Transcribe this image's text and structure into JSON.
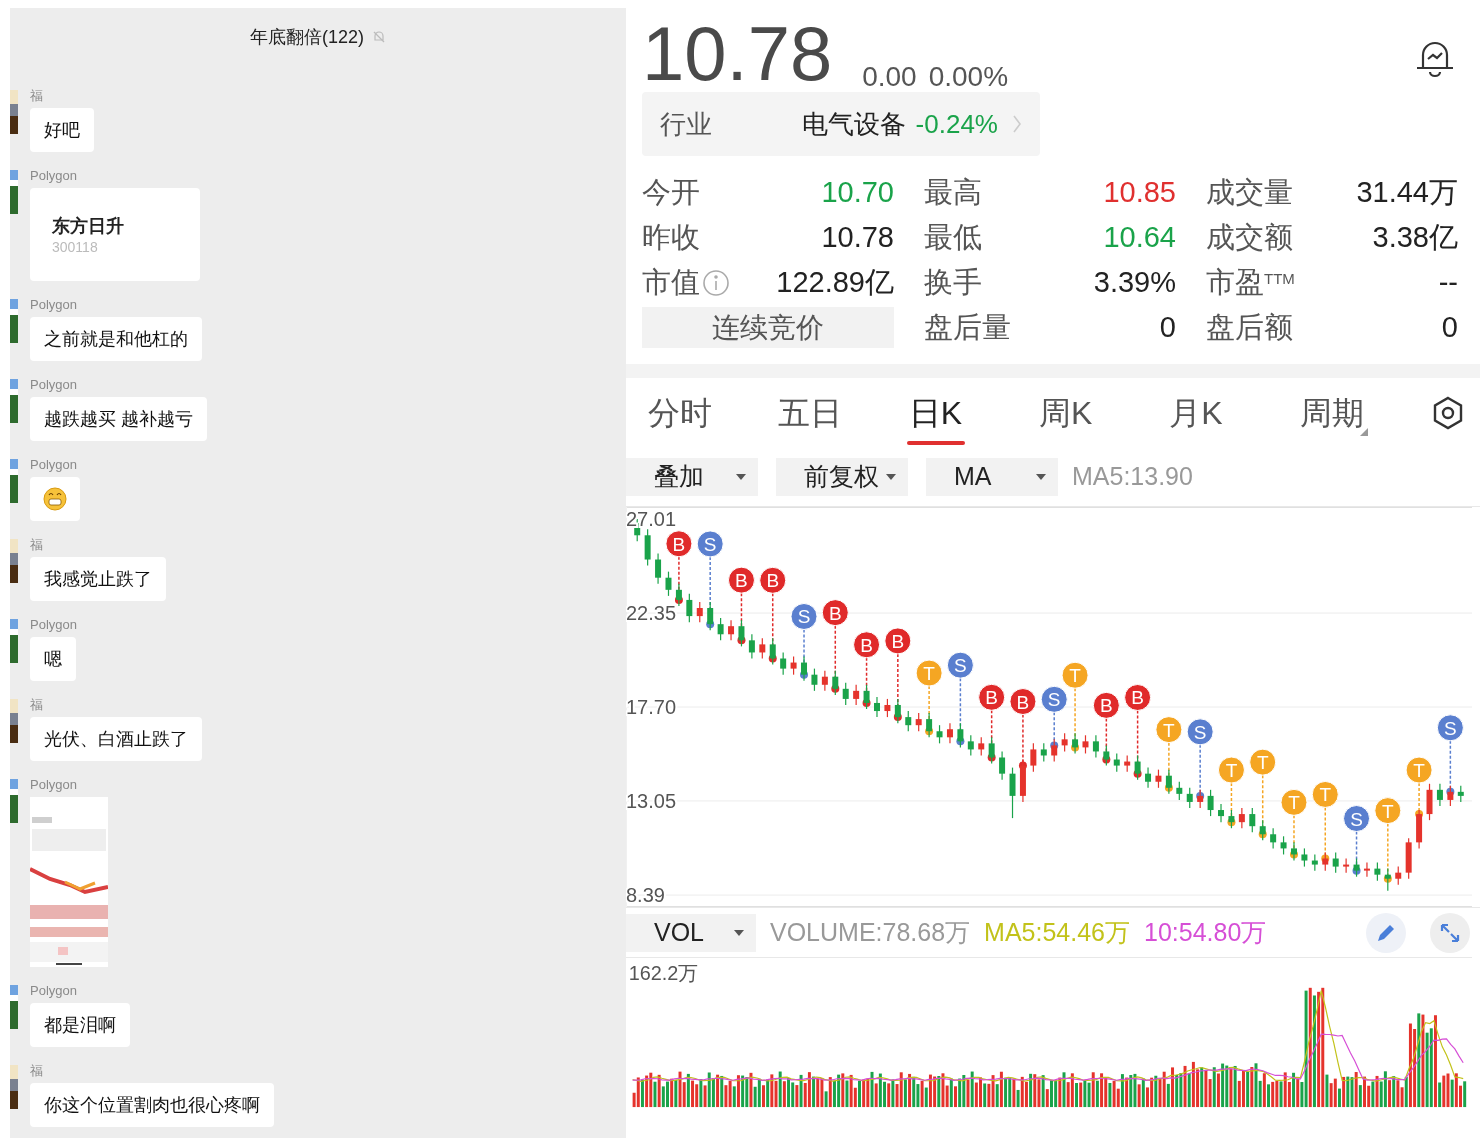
{
  "chat": {
    "title": "年底翻倍(122)",
    "muted": true,
    "messages": [
      {
        "sender": "福",
        "kind": "text",
        "text": "好吧"
      },
      {
        "sender": "Polygon",
        "kind": "stock_card",
        "name": "东方日升",
        "code": "300118"
      },
      {
        "sender": "Polygon",
        "kind": "text",
        "text": "之前就是和他杠的"
      },
      {
        "sender": "Polygon",
        "kind": "text",
        "text": "越跌越买 越补越亏"
      },
      {
        "sender": "Polygon",
        "kind": "emoji"
      },
      {
        "sender": "福",
        "kind": "text",
        "text": "我感觉止跌了"
      },
      {
        "sender": "Polygon",
        "kind": "text",
        "text": "嗯"
      },
      {
        "sender": "福",
        "kind": "text",
        "text": "光伏、白酒止跌了"
      },
      {
        "sender": "Polygon"
      },
      {
        "sender": "Polygon",
        "kind": "text",
        "text": "都是泪啊"
      },
      {
        "sender": "福",
        "kind": "text",
        "text": "你这个位置割肉也很心疼啊"
      }
    ]
  },
  "quote": {
    "price": "10.78",
    "change": "0.00",
    "change_pct": "0.00%",
    "industry": {
      "label": "行业",
      "name": "电气设备",
      "change": "-0.24%"
    },
    "stats": [
      {
        "kind": "stat",
        "label": "今开",
        "value": "10.70",
        "color": "#1aa34a",
        "info": false
      },
      {
        "kind": "stat",
        "label": "最高",
        "value": "10.85",
        "color": "#e0302f",
        "info": false
      },
      {
        "kind": "stat",
        "label": "成交量",
        "value": "31.44万",
        "color": "#222222",
        "info": false
      },
      {
        "kind": "stat",
        "label": "昨收",
        "value": "10.78",
        "color": "#222222",
        "info": false
      },
      {
        "kind": "stat",
        "label": "最低",
        "value": "10.64",
        "color": "#1aa34a",
        "info": false
      },
      {
        "kind": "stat",
        "label": "成交额",
        "value": "3.38亿",
        "color": "#222222",
        "info": false
      },
      {
        "kind": "stat",
        "label": "市值",
        "value": "122.89亿",
        "color": "#222222",
        "info": true
      },
      {
        "kind": "stat",
        "label": "换手",
        "value": "3.39%",
        "color": "#222222",
        "info": false
      },
      {
        "kind": "stat",
        "label": "市盈$^{TTM}$",
        "value": "--",
        "color": "#222222",
        "info": false
      },
      {
        "kind": "button",
        "label": "连续竞价"
      },
      {
        "kind": "stat",
        "label": "盘后量",
        "value": "0",
        "color": "#222222",
        "info": false
      },
      {
        "kind": "stat",
        "label": "盘后额",
        "value": "0",
        "color": "#222222",
        "info": false
      }
    ]
  },
  "tabs": [
    {
      "label": "分时",
      "selected": false,
      "menu": false
    },
    {
      "label": "五日",
      "selected": false,
      "menu": false
    },
    {
      "label": "日K",
      "selected": true,
      "menu": false
    },
    {
      "label": "周K",
      "selected": false,
      "menu": false
    },
    {
      "label": "月K",
      "selected": false,
      "menu": false
    },
    {
      "label": "周期",
      "selected": false,
      "menu": true
    }
  ],
  "toolbar": {
    "dropdowns": [
      "叠加",
      "前复权",
      "MA"
    ],
    "reading": "MA5:13.90"
  },
  "chart": {
    "chart_data": {
      "type": "candlestick",
      "grid": true,
      "ylim": [
        7.8,
        27.6
      ],
      "yticks": [
        {
          "value": 27.01,
          "label": "27.01"
        },
        {
          "value": 22.35,
          "label": "22.35"
        },
        {
          "value": 17.7,
          "label": "17.70"
        },
        {
          "value": 13.05,
          "label": "13.05"
        },
        {
          "value": 8.39,
          "label": "8.39"
        }
      ],
      "ohlc": [
        [
          26.8,
          27.0,
          25.9,
          26.2
        ],
        [
          26.2,
          26.5,
          24.7,
          25.0
        ],
        [
          25.0,
          25.3,
          23.8,
          24.1
        ],
        [
          24.1,
          24.4,
          23.2,
          23.5
        ],
        [
          23.5,
          23.8,
          22.7,
          23.0
        ],
        [
          23.0,
          23.3,
          21.9,
          22.2
        ],
        [
          22.2,
          22.9,
          21.9,
          22.6
        ],
        [
          22.6,
          22.9,
          21.5,
          21.8
        ],
        [
          21.8,
          22.1,
          21.0,
          21.3
        ],
        [
          21.3,
          22.0,
          21.0,
          21.7
        ],
        [
          21.7,
          22.0,
          20.7,
          21.0
        ],
        [
          21.0,
          21.3,
          20.1,
          20.4
        ],
        [
          20.4,
          21.1,
          20.1,
          20.8
        ],
        [
          20.8,
          21.1,
          19.8,
          20.1
        ],
        [
          20.1,
          20.4,
          19.3,
          19.6
        ],
        [
          19.6,
          20.2,
          19.3,
          19.9
        ],
        [
          19.9,
          20.2,
          19.0,
          19.3
        ],
        [
          19.3,
          19.6,
          18.5,
          18.8
        ],
        [
          18.8,
          19.5,
          18.5,
          19.2
        ],
        [
          19.2,
          19.5,
          18.3,
          18.6
        ],
        [
          18.6,
          18.9,
          17.8,
          18.1
        ],
        [
          18.1,
          18.8,
          17.8,
          18.5
        ],
        [
          18.5,
          18.8,
          17.6,
          17.9
        ],
        [
          17.9,
          18.2,
          17.2,
          17.5
        ],
        [
          17.5,
          18.1,
          17.2,
          17.8
        ],
        [
          17.8,
          18.1,
          16.9,
          17.2
        ],
        [
          17.2,
          17.5,
          16.5,
          16.8
        ],
        [
          16.8,
          17.4,
          16.5,
          17.1
        ],
        [
          17.1,
          17.4,
          16.2,
          16.5
        ],
        [
          16.5,
          16.8,
          15.9,
          16.2
        ],
        [
          16.2,
          16.9,
          15.9,
          16.6
        ],
        [
          16.6,
          16.9,
          15.7,
          16.0
        ],
        [
          16.0,
          16.3,
          15.3,
          15.6
        ],
        [
          15.6,
          16.2,
          15.3,
          15.9
        ],
        [
          15.9,
          16.2,
          14.9,
          15.2
        ],
        [
          15.2,
          15.5,
          14.1,
          14.4
        ],
        [
          14.4,
          14.7,
          12.2,
          13.3
        ],
        [
          13.3,
          15.1,
          13.0,
          14.8
        ],
        [
          14.8,
          15.9,
          14.5,
          15.6
        ],
        [
          15.6,
          15.9,
          15.0,
          15.3
        ],
        [
          15.3,
          16.1,
          15.0,
          15.8
        ],
        [
          15.8,
          16.4,
          15.5,
          16.1
        ],
        [
          16.1,
          16.4,
          15.4,
          15.7
        ],
        [
          15.7,
          16.3,
          15.4,
          16.0
        ],
        [
          16.0,
          16.3,
          15.2,
          15.5
        ],
        [
          15.5,
          15.8,
          14.8,
          15.1
        ],
        [
          15.1,
          15.4,
          14.5,
          14.8
        ],
        [
          14.8,
          15.3,
          14.5,
          15.0
        ],
        [
          15.0,
          15.3,
          14.1,
          14.4
        ],
        [
          14.4,
          14.7,
          13.7,
          14.0
        ],
        [
          14.0,
          14.6,
          13.7,
          14.3
        ],
        [
          14.3,
          14.6,
          13.4,
          13.7
        ],
        [
          13.7,
          14.0,
          13.1,
          13.4
        ],
        [
          13.4,
          13.7,
          12.7,
          13.0
        ],
        [
          13.0,
          13.6,
          12.7,
          13.3
        ],
        [
          13.3,
          13.6,
          12.3,
          12.6
        ],
        [
          12.6,
          12.9,
          12.0,
          12.3
        ],
        [
          12.3,
          12.6,
          11.7,
          12.0
        ],
        [
          12.0,
          12.7,
          11.7,
          12.4
        ],
        [
          12.4,
          12.7,
          11.5,
          11.8
        ],
        [
          11.8,
          12.1,
          11.1,
          11.4
        ],
        [
          11.4,
          11.7,
          10.7,
          11.0
        ],
        [
          11.0,
          11.3,
          10.4,
          10.7
        ],
        [
          10.7,
          11.0,
          10.1,
          10.4
        ],
        [
          10.4,
          10.7,
          9.8,
          10.1
        ],
        [
          10.1,
          10.4,
          9.6,
          9.9
        ],
        [
          9.9,
          10.5,
          9.6,
          10.2
        ],
        [
          10.2,
          10.5,
          9.5,
          9.8
        ],
        [
          9.8,
          10.2,
          9.5,
          9.9
        ],
        [
          9.9,
          10.2,
          9.3,
          9.6
        ],
        [
          9.6,
          10.0,
          9.3,
          9.7
        ],
        [
          9.7,
          10.0,
          9.1,
          9.4
        ],
        [
          9.4,
          9.7,
          8.6,
          9.2
        ],
        [
          9.2,
          9.8,
          8.9,
          9.5
        ],
        [
          9.5,
          11.2,
          9.2,
          11.0
        ],
        [
          11.0,
          12.6,
          10.7,
          12.4
        ],
        [
          12.4,
          13.9,
          12.1,
          13.6
        ],
        [
          13.6,
          13.9,
          12.8,
          13.1
        ],
        [
          13.1,
          13.8,
          12.8,
          13.5
        ],
        [
          13.5,
          13.8,
          13.0,
          13.3
        ]
      ]
    },
    "markers": [
      {
        "label": "B",
        "kind": "buy"
      },
      {
        "label": "S",
        "kind": "sell"
      },
      {
        "label": "B",
        "kind": "buy"
      },
      {
        "label": "B",
        "kind": "buy"
      },
      {
        "label": "S",
        "kind": "sell"
      },
      {
        "label": "B",
        "kind": "buy"
      },
      {
        "label": "B",
        "kind": "buy"
      },
      {
        "label": "B",
        "kind": "buy"
      },
      {
        "label": "T",
        "kind": "t"
      },
      {
        "label": "S",
        "kind": "sell"
      },
      {
        "label": "B",
        "kind": "buy"
      },
      {
        "label": "B",
        "kind": "buy"
      },
      {
        "label": "S",
        "kind": "sell"
      },
      {
        "label": "T",
        "kind": "t"
      },
      {
        "label": "B",
        "kind": "buy"
      },
      {
        "label": "B",
        "kind": "buy"
      },
      {
        "label": "T",
        "kind": "t"
      },
      {
        "label": "S",
        "kind": "sell"
      },
      {
        "label": "T",
        "kind": "t"
      },
      {
        "label": "T",
        "kind": "t"
      },
      {
        "label": "T",
        "kind": "t"
      },
      {
        "label": "T",
        "kind": "t"
      },
      {
        "label": "S",
        "kind": "sell"
      },
      {
        "label": "T",
        "kind": "t"
      },
      {
        "label": "T",
        "kind": "t"
      },
      {
        "label": "S",
        "kind": "sell"
      }
    ]
  },
  "volume": {
    "indicator": "VOL",
    "readings": [
      {
        "text": "VOLUME:78.68万",
        "color": "#999999"
      },
      {
        "text": "MA5:54.46万",
        "color": "#c2c21a"
      },
      {
        "text": "10:54.80万",
        "color": "#d64fd6"
      }
    ],
    "axis_label": "162.2万"
  }
}
